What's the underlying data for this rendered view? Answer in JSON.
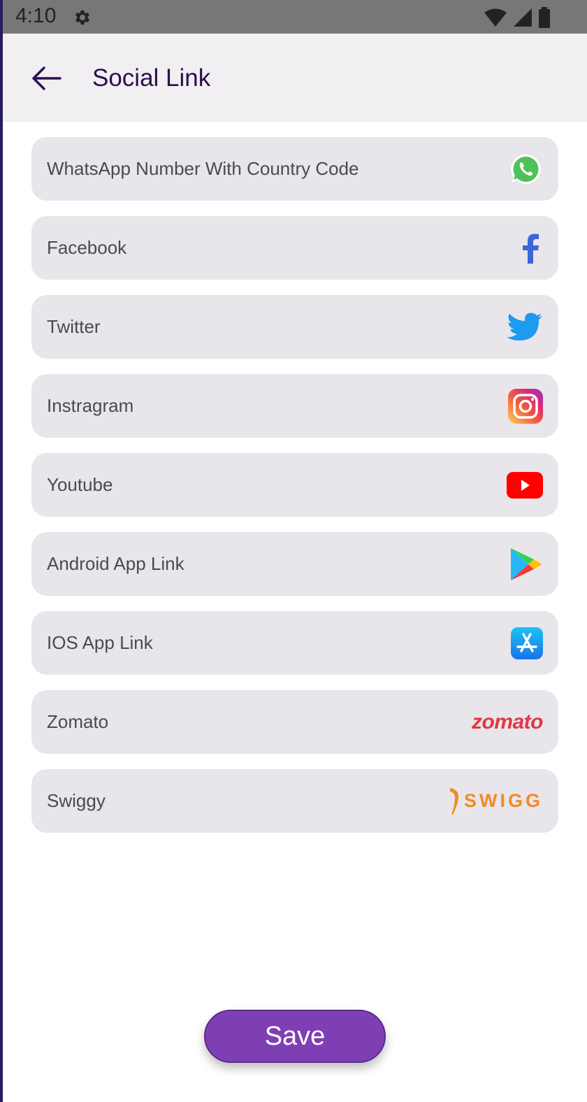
{
  "status_bar": {
    "time": "4:10"
  },
  "app_bar": {
    "title": "Social Link"
  },
  "fields": [
    {
      "label": "WhatsApp Number With Country Code",
      "icon": "whatsapp-icon"
    },
    {
      "label": "Facebook",
      "icon": "facebook-icon"
    },
    {
      "label": "Twitter",
      "icon": "twitter-icon"
    },
    {
      "label": "Instragram",
      "icon": "instagram-icon"
    },
    {
      "label": "Youtube",
      "icon": "youtube-icon"
    },
    {
      "label": "Android App Link",
      "icon": "google-play-icon"
    },
    {
      "label": "IOS App Link",
      "icon": "app-store-icon"
    },
    {
      "label": "Zomato",
      "icon": "zomato-logo",
      "logo_text": "zomato"
    },
    {
      "label": "Swiggy",
      "icon": "swiggy-logo",
      "logo_text": "SWIGG"
    }
  ],
  "save_button": {
    "label": "Save"
  },
  "colors": {
    "accent": "#7f3fb4",
    "title": "#2c0f4e",
    "field_bg": "#e8e6eb",
    "app_bar_bg": "#f1eff1"
  }
}
